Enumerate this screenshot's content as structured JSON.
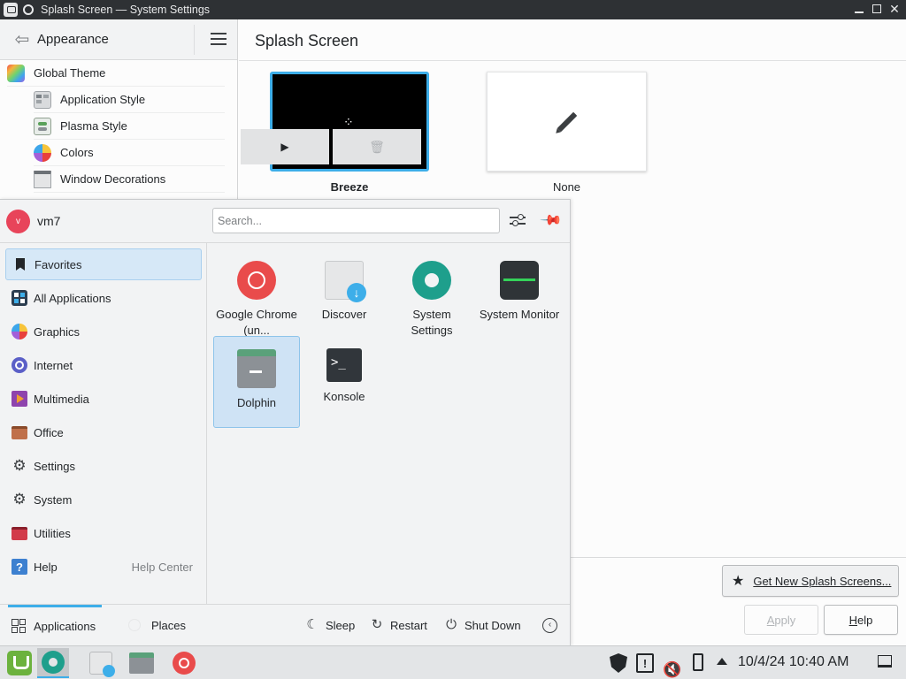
{
  "window": {
    "title": "Splash Screen — System Settings"
  },
  "sidebar": {
    "title": "Appearance",
    "items": [
      {
        "label": "Global Theme",
        "icon": "global-theme-icon"
      },
      {
        "label": "Application Style",
        "icon": "application-style-icon"
      },
      {
        "label": "Plasma Style",
        "icon": "plasma-style-icon"
      },
      {
        "label": "Colors",
        "icon": "colors-icon"
      },
      {
        "label": "Window Decorations",
        "icon": "window-decorations-icon"
      }
    ]
  },
  "main": {
    "title": "Splash Screen",
    "themes": [
      {
        "name": "Breeze",
        "selected": true
      },
      {
        "name": "None",
        "selected": false
      }
    ],
    "get_new_label": "Get New Splash Screens...",
    "apply_label": "Apply",
    "help_label": "Help"
  },
  "launcher": {
    "user": {
      "name": "vm7",
      "initial": "v"
    },
    "search_placeholder": "Search...",
    "categories": [
      {
        "label": "Favorites",
        "selected": true
      },
      {
        "label": "All Applications"
      },
      {
        "label": "Graphics"
      },
      {
        "label": "Internet"
      },
      {
        "label": "Multimedia"
      },
      {
        "label": "Office"
      },
      {
        "label": "Settings"
      },
      {
        "label": "System"
      },
      {
        "label": "Utilities"
      },
      {
        "label": "Help",
        "extra": "Help Center"
      }
    ],
    "apps": [
      {
        "label": "Google Chrome (un...",
        "icon": "google-chrome-icon"
      },
      {
        "label": "Discover",
        "icon": "discover-icon"
      },
      {
        "label": "System Settings",
        "icon": "system-settings-icon"
      },
      {
        "label": "System Monitor",
        "icon": "system-monitor-icon"
      },
      {
        "label": "Dolphin",
        "icon": "dolphin-icon",
        "selected": true
      },
      {
        "label": "Konsole",
        "icon": "konsole-icon"
      }
    ],
    "tabs": [
      {
        "label": "Applications",
        "active": true
      },
      {
        "label": "Places"
      }
    ],
    "power": {
      "sleep": "Sleep",
      "restart": "Restart",
      "shutdown": "Shut Down"
    }
  },
  "taskbar": {
    "clock": "10/4/24 10:40 AM"
  },
  "colors": {
    "accent": "#3daee9",
    "selection_bg": "#d6e8f7",
    "titlebar": "#2e3134"
  }
}
